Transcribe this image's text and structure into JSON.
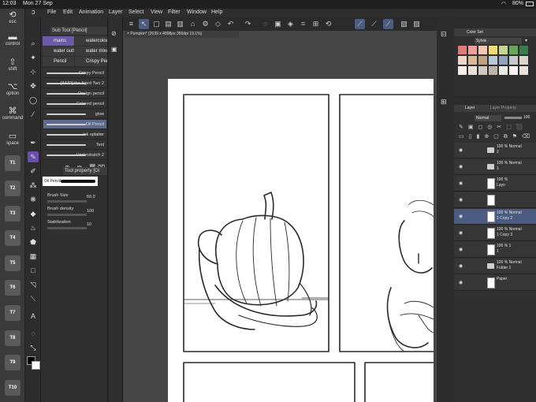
{
  "status": {
    "time": "12:03",
    "date": "Mon 27 Sep",
    "battery": "80%"
  },
  "modifiers": [
    {
      "label": "esc",
      "glyph": "⟲"
    },
    {
      "label": "control",
      "glyph": "▬"
    },
    {
      "label": "shift",
      "glyph": "⇧"
    },
    {
      "label": "option",
      "glyph": "⌥"
    },
    {
      "label": "command",
      "glyph": "⌘"
    },
    {
      "label": "space",
      "glyph": "▭"
    }
  ],
  "tkeys": [
    "T1",
    "T2",
    "T3",
    "T4",
    "T5",
    "T6",
    "T7",
    "T8",
    "T9",
    "T10"
  ],
  "menu": [
    "File",
    "Edit",
    "Animation",
    "Layer",
    "Select",
    "View",
    "Filter",
    "Window",
    "Help"
  ],
  "subtool": {
    "header": "Sub Tool [Pencil]",
    "groups": [
      "mains",
      "watercolou",
      "water outli",
      "water mixe",
      "Pencil",
      "Crispy Penc"
    ],
    "brushes": [
      "Crispy Pencil",
      "[ASIR] the Aged Two 2",
      "Design pencil",
      "Colored pencil",
      "glow",
      "Oil Pencil",
      "ink splatter",
      "Text",
      "Underskatch 2"
    ],
    "property_header": "Tool property [Oi",
    "brush_name": "Oil Pencil",
    "props": [
      {
        "label": "Brush Size",
        "value": "60.0"
      },
      {
        "label": "Brush density",
        "value": "100"
      },
      {
        "label": "Stabilization",
        "value": "10"
      }
    ]
  },
  "document_tab": "Pumpkin* (2039 x 4898px 350dpi 19.1%)",
  "colorset": {
    "title": "Color Set",
    "set_name": "Sylvie",
    "swatches": [
      "#e07a78",
      "#e8a19a",
      "#f3c8b8",
      "#f5dc78",
      "#c6d890",
      "#6aa55e",
      "#3e7b4c",
      "#ecd7c9",
      "#d9b89a",
      "#c4a07c",
      "#b8c8d8",
      "#8fa3bf",
      "#c9c9c9",
      "#dcd5cc",
      "#f4efe9",
      "#e8e1d8",
      "#d1cac1",
      "#bcb5ad",
      "#ece8e4",
      "#f7f4f1",
      "#e9e3de"
    ]
  },
  "layer_panel": {
    "tabs": [
      "Layer",
      "Layer Property"
    ],
    "blend_mode": "Normal",
    "opacity": "100",
    "layers": [
      {
        "name": "100 % Normal\n2",
        "kind": "folder"
      },
      {
        "name": "100 % Normal\n1",
        "kind": "folder"
      },
      {
        "name": "100 %\nLayo",
        "kind": "layer"
      },
      {
        "name": "",
        "kind": "layer"
      },
      {
        "name": "100 % Normal\n1 Copy 2",
        "kind": "layer",
        "selected": true
      },
      {
        "name": "100 % Normal\n1 Copy 3",
        "kind": "layer"
      },
      {
        "name": "100 % 1\n1",
        "kind": "layer"
      },
      {
        "name": "100 % Normal\nFolder 1",
        "kind": "folder"
      },
      {
        "name": "Paper",
        "kind": "paper"
      }
    ]
  }
}
